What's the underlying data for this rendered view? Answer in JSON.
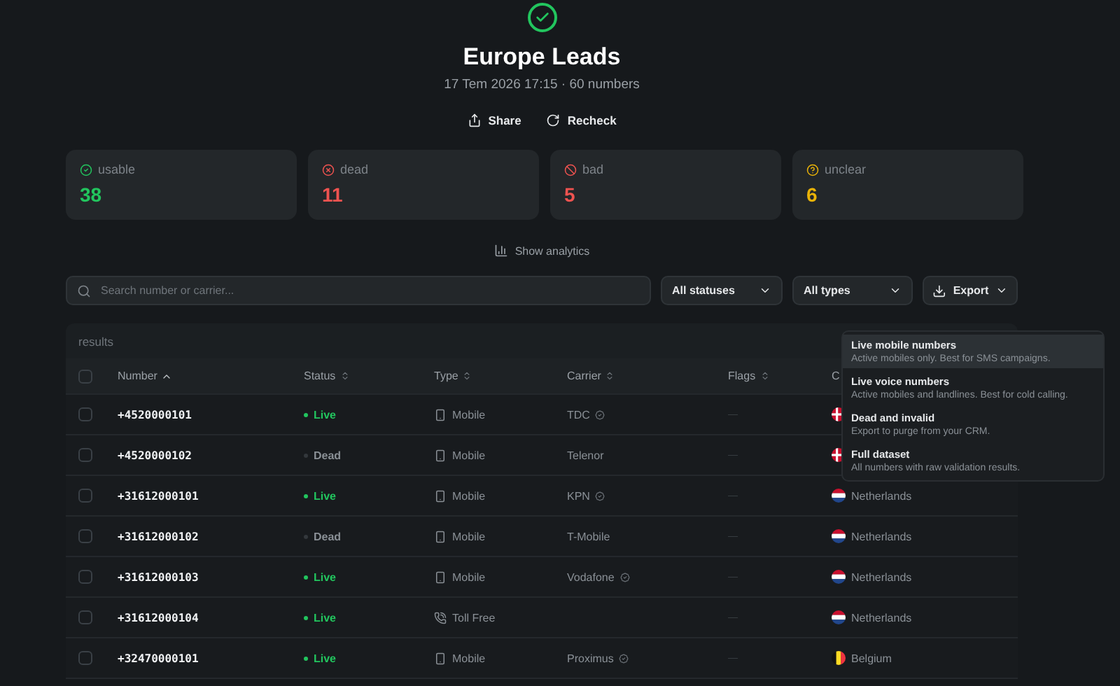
{
  "header": {
    "title": "Europe Leads",
    "subtitle": "17 Tem 2026 17:15 · 60 numbers",
    "actions": [
      {
        "kind": "share",
        "label": "Share"
      },
      {
        "kind": "recheck",
        "label": "Recheck"
      }
    ]
  },
  "stats": [
    {
      "kind": "usable",
      "label": "usable",
      "value": "38",
      "color": "#22c55e"
    },
    {
      "kind": "dead",
      "label": "dead",
      "value": "11",
      "color": "#ef5350"
    },
    {
      "kind": "bad",
      "label": "bad",
      "value": "5",
      "color": "#ef5350"
    },
    {
      "kind": "unclear",
      "label": "unclear",
      "value": "6",
      "color": "#eab308"
    }
  ],
  "analytics_toggle": "Show analytics",
  "toolbar": {
    "search": {
      "placeholder": "Search number or carrier..."
    },
    "status_filter": "All statuses",
    "type_filter": "All types",
    "export": "Export"
  },
  "table": {
    "caption": "results",
    "header_checked": false,
    "columns": [
      {
        "label": "Number",
        "sorted": true
      },
      {
        "label": "Status",
        "sorted": false
      },
      {
        "label": "Type",
        "sorted": false
      },
      {
        "label": "Carrier",
        "sorted": false
      },
      {
        "label": "Flags",
        "sorted": false
      },
      {
        "label": "C"
      }
    ],
    "rows": [
      {
        "checked": false,
        "number": "+4520000101",
        "status": {
          "label": "Live",
          "kind": "live"
        },
        "type": {
          "label": "Mobile",
          "kind": "mobile"
        },
        "carrier": "TDC",
        "verified": true,
        "flags": "—",
        "country": {
          "kind": "dk"
        }
      },
      {
        "checked": false,
        "number": "+4520000102",
        "status": {
          "label": "Dead",
          "kind": "dead"
        },
        "type": {
          "label": "Mobile",
          "kind": "mobile"
        },
        "carrier": "Telenor",
        "verified": false,
        "flags": "—",
        "country": {
          "kind": "dk"
        }
      },
      {
        "checked": false,
        "number": "+31612000101",
        "status": {
          "label": "Live",
          "kind": "live"
        },
        "type": {
          "label": "Mobile",
          "kind": "mobile"
        },
        "carrier": "KPN",
        "verified": true,
        "flags": "—",
        "country": {
          "kind": "nl",
          "name": "Netherlands"
        }
      },
      {
        "checked": false,
        "number": "+31612000102",
        "status": {
          "label": "Dead",
          "kind": "dead"
        },
        "type": {
          "label": "Mobile",
          "kind": "mobile"
        },
        "carrier": "T-Mobile",
        "verified": false,
        "flags": "—",
        "country": {
          "kind": "nl",
          "name": "Netherlands"
        }
      },
      {
        "checked": false,
        "number": "+31612000103",
        "status": {
          "label": "Live",
          "kind": "live"
        },
        "type": {
          "label": "Mobile",
          "kind": "mobile"
        },
        "carrier": "Vodafone",
        "verified": true,
        "flags": "—",
        "country": {
          "kind": "nl",
          "name": "Netherlands"
        }
      },
      {
        "checked": false,
        "number": "+31612000104",
        "status": {
          "label": "Live",
          "kind": "live"
        },
        "type": {
          "label": "Toll Free",
          "kind": "tollfree"
        },
        "verified": false,
        "flags": "—",
        "country": {
          "kind": "nl",
          "name": "Netherlands"
        }
      },
      {
        "checked": false,
        "number": "+32470000101",
        "status": {
          "label": "Live",
          "kind": "live"
        },
        "type": {
          "label": "Mobile",
          "kind": "mobile"
        },
        "carrier": "Proximus",
        "verified": true,
        "flags": "—",
        "country": {
          "kind": "be",
          "name": "Belgium"
        }
      }
    ]
  },
  "export_menu": [
    {
      "title": "Live mobile numbers",
      "description": "Active mobiles only. Best for SMS campaigns.",
      "selected": true
    },
    {
      "title": "Live voice numbers",
      "description": "Active mobiles and landlines. Best for cold calling.",
      "selected": false
    },
    {
      "title": "Dead and invalid",
      "description": "Export to purge from your CRM.",
      "selected": false
    },
    {
      "title": "Full dataset",
      "description": "All numbers with raw validation results.",
      "selected": false
    }
  ]
}
